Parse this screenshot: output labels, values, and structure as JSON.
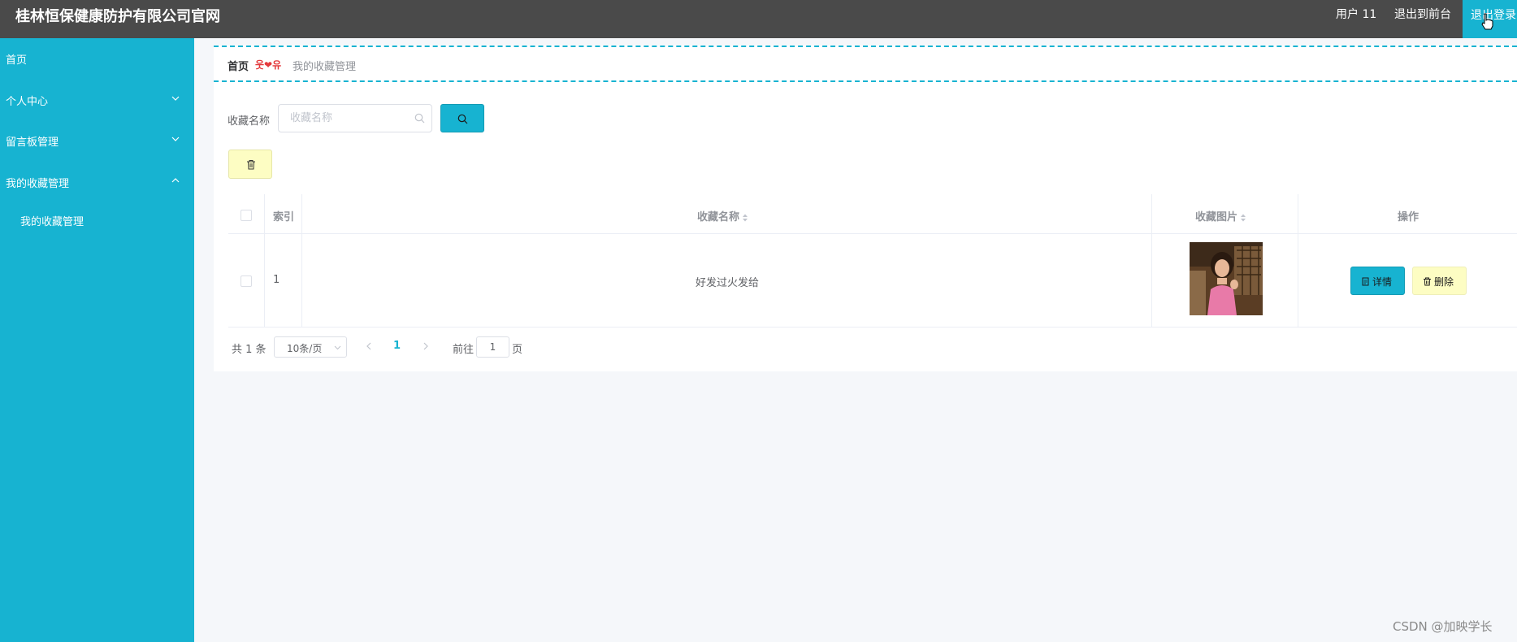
{
  "header": {
    "title": "桂林恒保健康防护有限公司官网",
    "user": "用户 11",
    "to_front": "退出到前台",
    "logout": "退出登录"
  },
  "sidebar": {
    "items": [
      {
        "label": "首页"
      },
      {
        "label": "个人中心"
      },
      {
        "label": "留言板管理"
      },
      {
        "label": "我的收藏管理"
      }
    ],
    "subitems": [
      {
        "label": "我的收藏管理"
      }
    ]
  },
  "breadcrumb": {
    "home": "首页",
    "separator": "웃❤유",
    "current": "我的收藏管理"
  },
  "search": {
    "label": "收藏名称",
    "placeholder": "收藏名称",
    "value": ""
  },
  "table": {
    "columns": [
      "索引",
      "收藏名称",
      "收藏图片",
      "操作"
    ],
    "rows": [
      {
        "index": "1",
        "name": "好发过火发给",
        "image": "photo"
      }
    ],
    "detail_label": "详情",
    "delete_label": "删除"
  },
  "pagination": {
    "total": "共 1 条",
    "page_size": "10条/页",
    "current": "1",
    "goto_prefix": "前往",
    "goto_value": "1",
    "goto_suffix": "页"
  },
  "watermark": "CSDN @加映学长",
  "colors": {
    "accent": "#17b3d1",
    "header": "#4a4a4a",
    "warning_button": "#fdfdc3"
  }
}
